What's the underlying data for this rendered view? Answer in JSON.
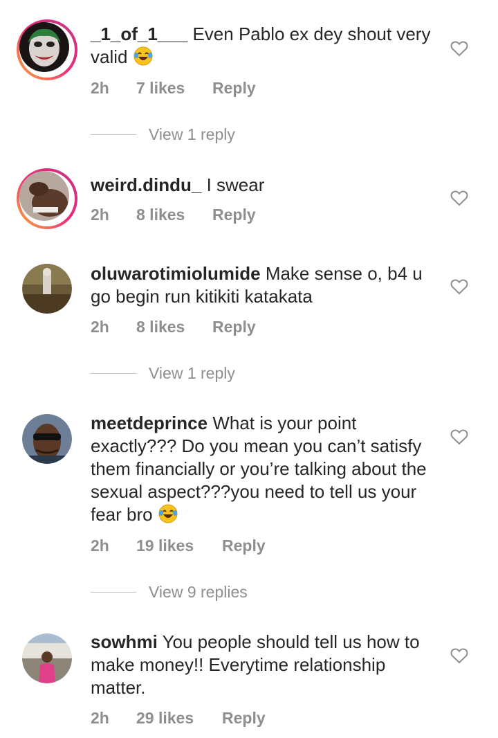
{
  "comments": [
    {
      "username": "_1_of_1___",
      "text": "Even Pablo ex dey shout very valid",
      "time": "2h",
      "likes": "7 likes",
      "reply": "Reply",
      "view_replies": "View 1 reply",
      "has_story_ring": true,
      "emoji": "face-with-tears-of-joy"
    },
    {
      "username": "weird.dindu_",
      "text": "I swear",
      "time": "2h",
      "likes": "8 likes",
      "reply": "Reply",
      "has_story_ring": true
    },
    {
      "username": "oluwarotimiolumide",
      "text": "Make sense o, b4 u go begin run kitikiti katakata",
      "time": "2h",
      "likes": "8 likes",
      "reply": "Reply",
      "view_replies": "View 1 reply",
      "has_story_ring": false
    },
    {
      "username": "meetdeprince",
      "text": "What is your point exactly??? Do you mean you can’t satisfy them financially or you’re talking about the sexual aspect???you need to tell us your fear bro",
      "time": "2h",
      "likes": "19 likes",
      "reply": "Reply",
      "view_replies": "View 9 replies",
      "has_story_ring": false,
      "emoji": "face-with-tears-of-joy"
    },
    {
      "username": "sowhmi",
      "text": "You people should tell us how to make money!! Everytime relationship matter.",
      "time": "2h",
      "likes": "29 likes",
      "reply": "Reply",
      "has_story_ring": false
    }
  ],
  "colors": {
    "text": "#262626",
    "secondary": "#8e8e8e",
    "divider": "#c7c7c7",
    "ring_start": "#f9b233",
    "ring_end": "#c13584"
  }
}
